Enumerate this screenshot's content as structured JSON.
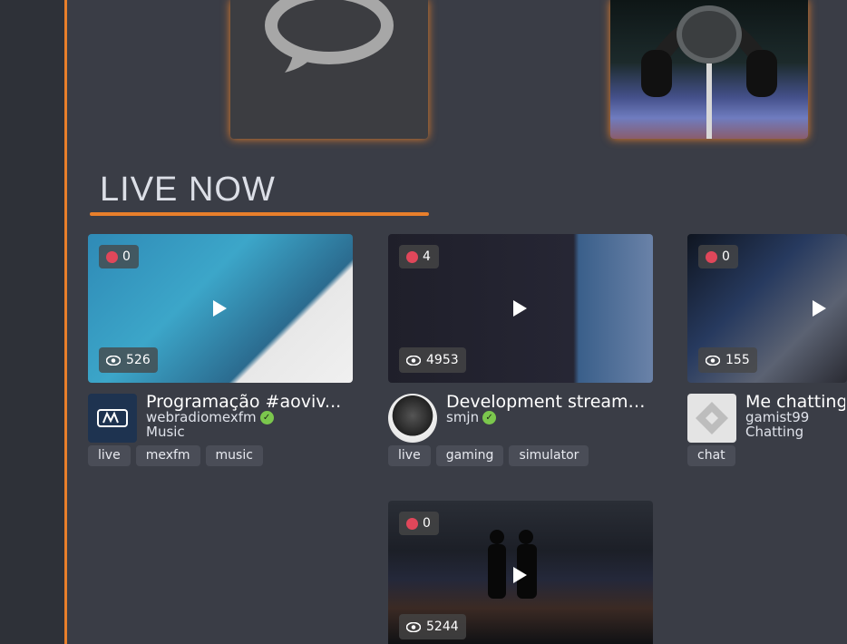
{
  "theme": {
    "accent": "#e87f2b",
    "background": "#3a3d46",
    "live_dot": "#e0475a",
    "verified": "#7bc74d"
  },
  "top_cards": [
    {
      "icon": "chat-bubble-icon"
    },
    {
      "icon": "headphones-image"
    }
  ],
  "section": {
    "title": "LIVE NOW"
  },
  "streams": [
    {
      "live_count": "0",
      "viewers": "526",
      "title": "Programação #aoviv...",
      "user": "webradiomexfm",
      "verified": true,
      "category": "Music",
      "tags": [
        "live",
        "mexfm",
        "music"
      ]
    },
    {
      "live_count": "4",
      "viewers": "4953",
      "title": "Development stream ...",
      "user": "smjn",
      "verified": true,
      "category": "",
      "tags": [
        "live",
        "gaming",
        "simulator"
      ]
    },
    {
      "live_count": "0",
      "viewers": "155",
      "title": "Me chatting",
      "user": "gamist99",
      "verified": false,
      "category": "Chatting",
      "tags": [
        "chat"
      ]
    },
    {
      "live_count": "0",
      "viewers": "5244"
    }
  ]
}
